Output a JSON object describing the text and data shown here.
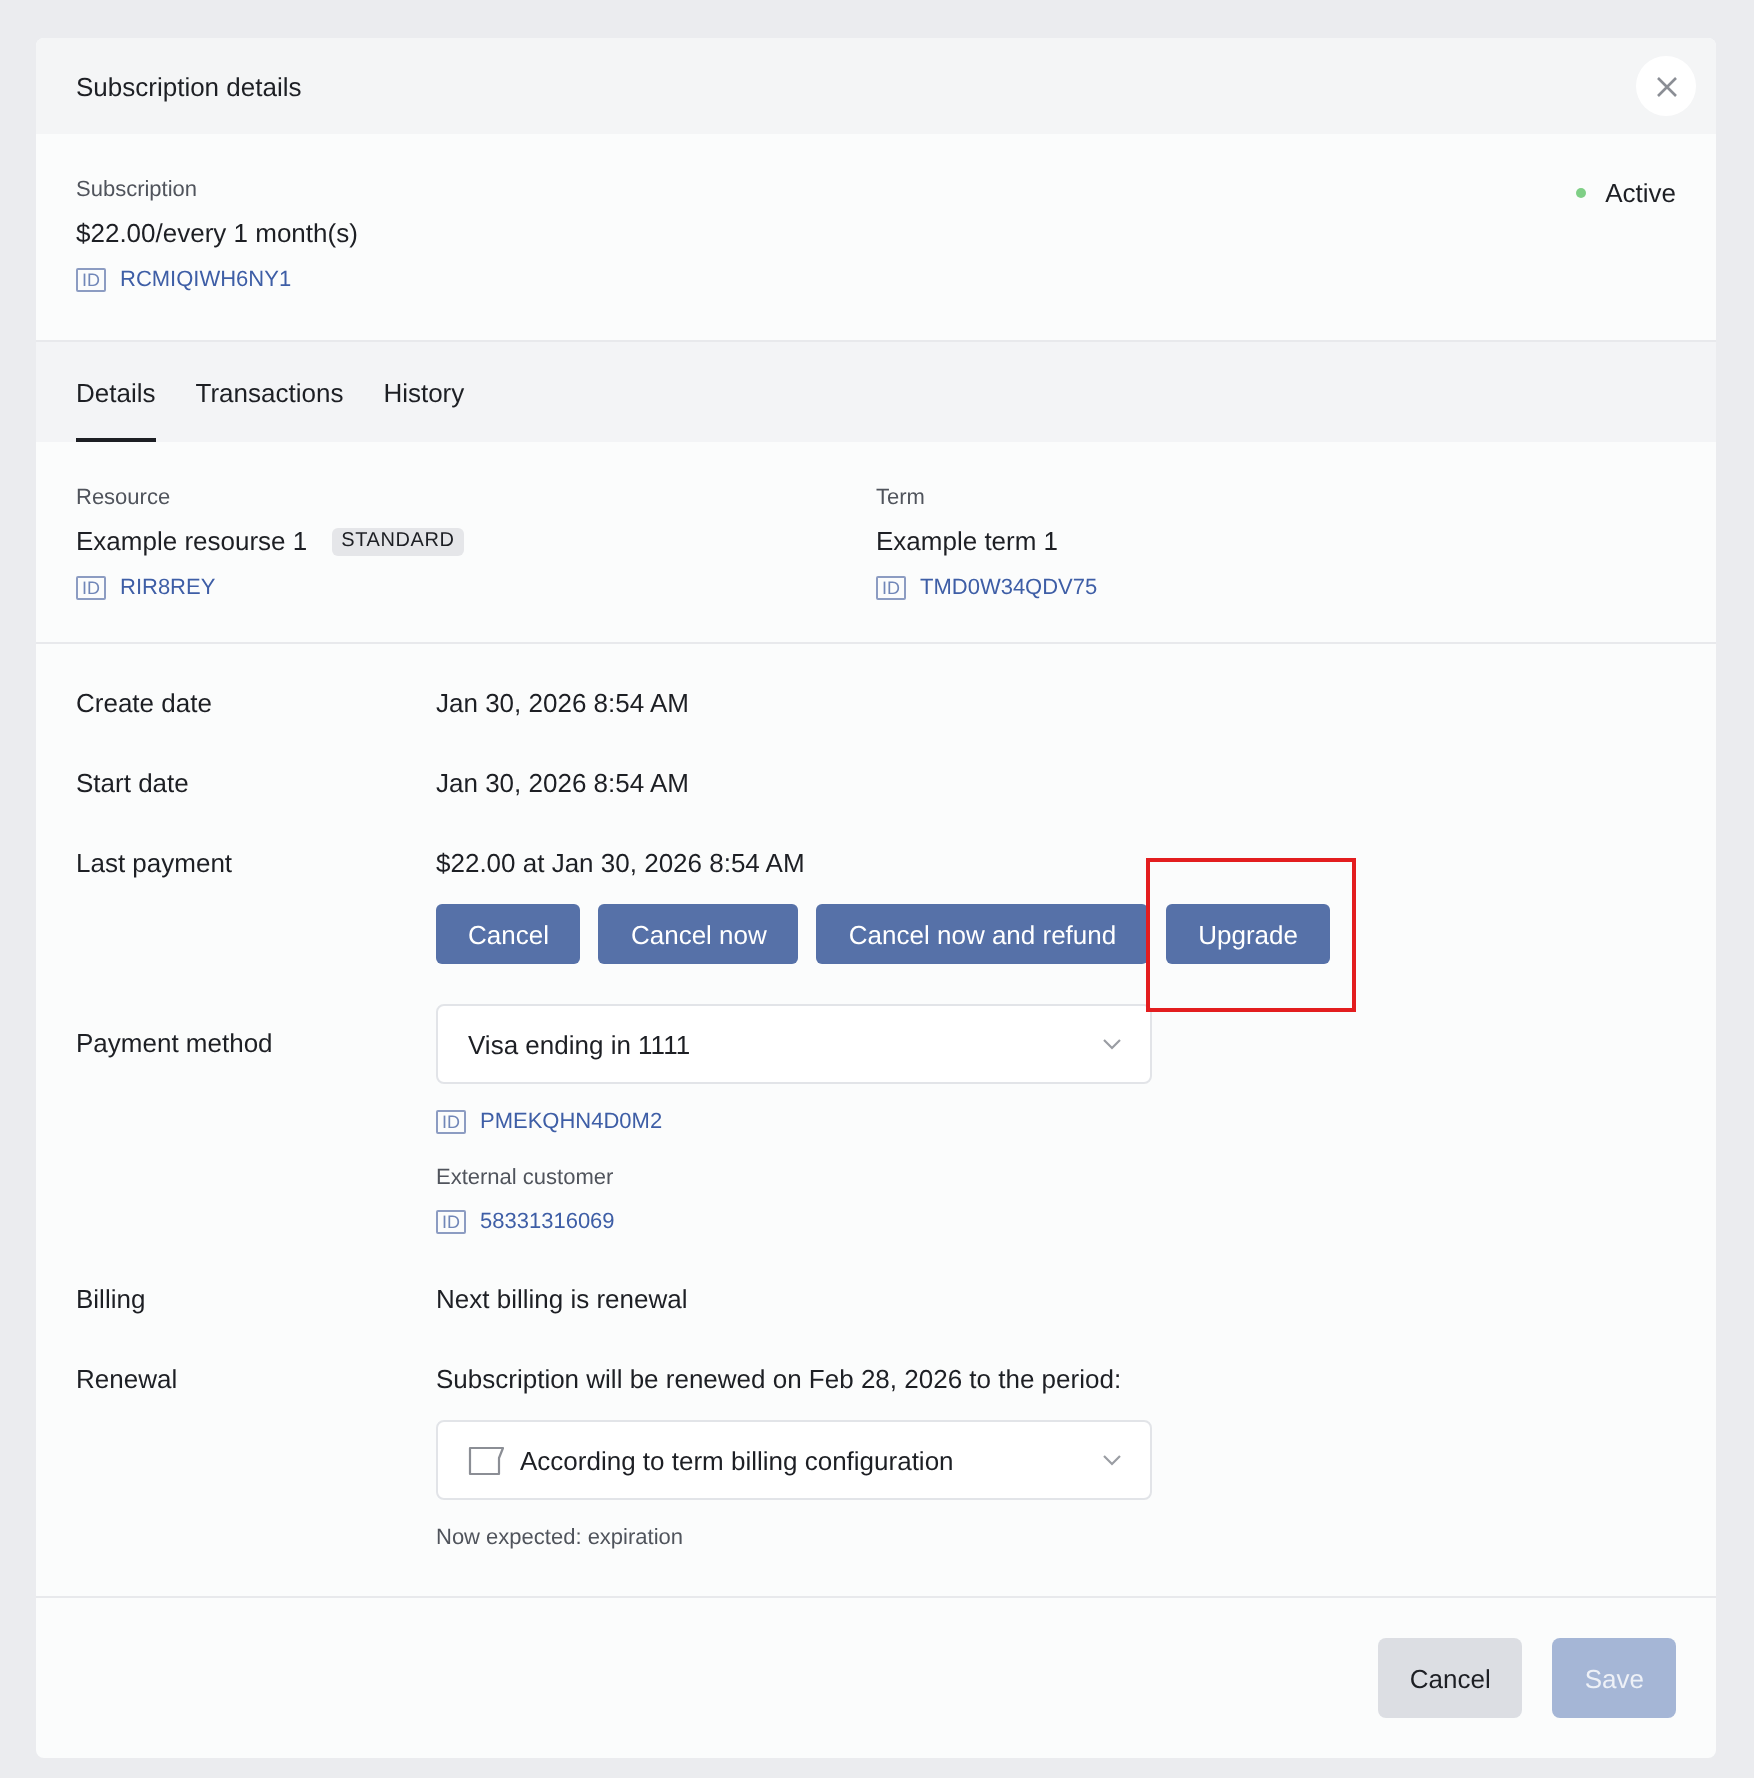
{
  "dialog": {
    "title": "Subscription details"
  },
  "subscription": {
    "label": "Subscription",
    "price": "$22.00/every 1 month(s)",
    "id": {
      "tag": "ID",
      "value": "RCMIQIWH6NY1"
    },
    "status": {
      "label": "Active",
      "color": "#7fcf86"
    }
  },
  "tabs": [
    {
      "label": "Details",
      "selected": true
    },
    {
      "label": "Transactions",
      "selected": false
    },
    {
      "label": "History",
      "selected": false
    }
  ],
  "references": [
    {
      "label": "Resource",
      "name": "Example resourse 1",
      "badge": "STANDARD",
      "id": {
        "tag": "ID",
        "value": "RIR8REY"
      }
    },
    {
      "label": "Term",
      "name": "Example term 1",
      "id": {
        "tag": "ID",
        "value": "TMD0W34QDV75"
      }
    }
  ],
  "fields": [
    {
      "label": "Create date",
      "content": [
        {
          "kind": "text",
          "text": "Jan 30, 2026 8:54 AM"
        }
      ]
    },
    {
      "label": "Start date",
      "content": [
        {
          "kind": "text",
          "text": "Jan 30, 2026 8:54 AM"
        }
      ]
    },
    {
      "label": "Last payment",
      "content": [
        {
          "kind": "text",
          "text": "$22.00 at Jan 30, 2026 8:54 AM"
        },
        {
          "kind": "actions",
          "buttons": [
            {
              "label": "Cancel",
              "highlighted": false
            },
            {
              "label": "Cancel now",
              "highlighted": false
            },
            {
              "label": "Cancel now and refund",
              "highlighted": false
            },
            {
              "label": "Upgrade",
              "highlighted": true
            }
          ]
        }
      ]
    },
    {
      "label": "Payment method",
      "content": [
        {
          "kind": "select",
          "value": "Visa ending in 1111"
        },
        {
          "kind": "id",
          "tag": "ID",
          "value": "PMEKQHN4D0M2"
        },
        {
          "kind": "caption",
          "text": "External customer"
        },
        {
          "kind": "id",
          "tag": "ID",
          "value": "58331316069"
        }
      ]
    },
    {
      "label": "Billing",
      "content": [
        {
          "kind": "text",
          "text": "Next billing is renewal"
        }
      ]
    },
    {
      "label": "Renewal",
      "content": [
        {
          "kind": "text",
          "text": "Subscription will be renewed on Feb 28, 2026 to the period:"
        },
        {
          "kind": "icon-select",
          "value": "According to term billing configuration"
        },
        {
          "kind": "caption",
          "text": "Now expected: expiration"
        }
      ]
    }
  ],
  "footer": {
    "buttons": [
      {
        "label": "Cancel",
        "kind": "secondary",
        "disabled": false
      },
      {
        "label": "Save",
        "kind": "primary",
        "disabled": true
      }
    ]
  }
}
